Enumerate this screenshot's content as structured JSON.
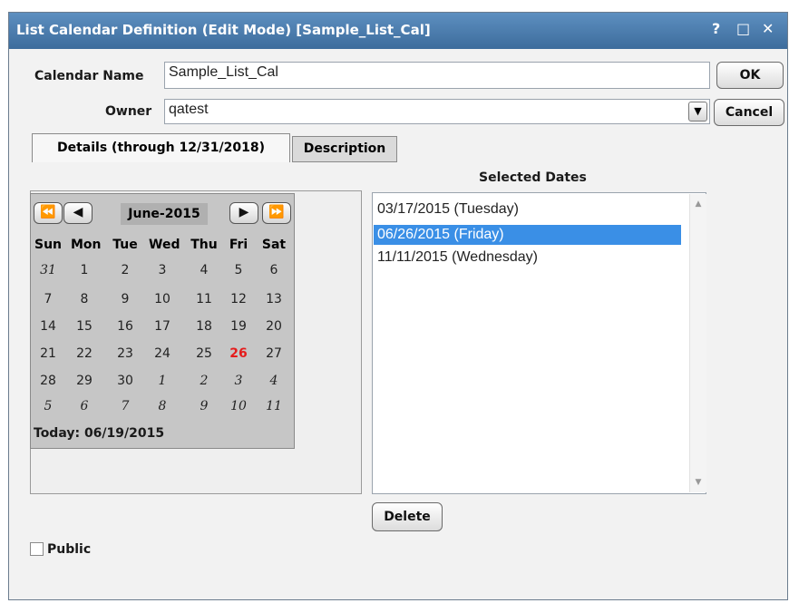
{
  "window": {
    "title": "List Calendar Definition (Edit Mode) [Sample_List_Cal]",
    "help_glyph": "?",
    "maximize_glyph": "□",
    "close_glyph": "✕"
  },
  "form": {
    "calendar_name_label": "Calendar Name",
    "calendar_name_value": "Sample_List_Cal",
    "owner_label": "Owner",
    "owner_value": "qatest"
  },
  "buttons": {
    "ok": "OK",
    "cancel": "Cancel",
    "delete": "Delete"
  },
  "tabs": [
    {
      "label": "Details (through 12/31/2018)",
      "active": true
    },
    {
      "label": "Description",
      "active": false
    }
  ],
  "calendar": {
    "month_label": "June-2015",
    "weekdays": [
      "Sun",
      "Mon",
      "Tue",
      "Wed",
      "Thu",
      "Fri",
      "Sat"
    ],
    "weeks": [
      [
        "31",
        "1",
        "2",
        "3",
        "4",
        "5",
        "6"
      ],
      [
        "7",
        "8",
        "9",
        "10",
        "11",
        "12",
        "13"
      ],
      [
        "14",
        "15",
        "16",
        "17",
        "18",
        "19",
        "20"
      ],
      [
        "21",
        "22",
        "23",
        "24",
        "25",
        "26",
        "27"
      ],
      [
        "28",
        "29",
        "30",
        "1",
        "2",
        "3",
        "4"
      ],
      [
        "5",
        "6",
        "7",
        "8",
        "9",
        "10",
        "11"
      ]
    ],
    "selected_day": "26",
    "today_text": "Today: 06/19/2015",
    "nav": {
      "prev_year": "⏪",
      "prev_month": "◀",
      "next_month": "▶",
      "next_year": "⏩"
    }
  },
  "selected_dates": {
    "heading": "Selected Dates",
    "items": [
      {
        "label": "03/17/2015 (Tuesday)",
        "selected": false
      },
      {
        "label": "06/26/2015 (Friday)",
        "selected": true
      },
      {
        "label": "11/11/2015 (Wednesday)",
        "selected": false
      }
    ]
  },
  "public_checkbox": {
    "label": "Public",
    "checked": false
  },
  "colors": {
    "title_bar": "#4a7db0",
    "selection": "#3a8fe6",
    "selected_day": "#e51c1c"
  }
}
